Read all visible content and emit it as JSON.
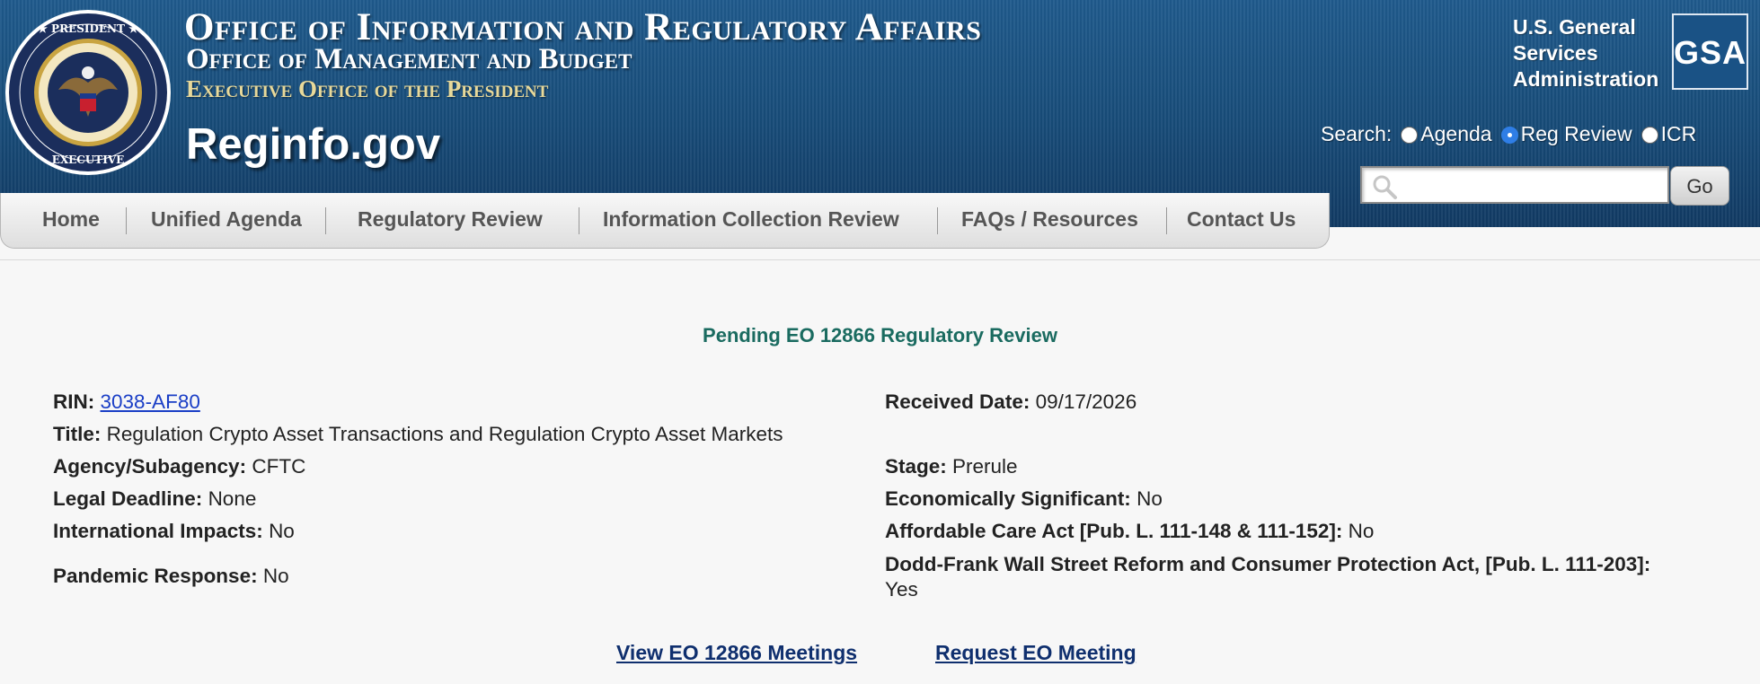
{
  "header": {
    "line1": "Office of Information and Regulatory Affairs",
    "line2": "Office of Management and Budget",
    "line3": "Executive Office of the President",
    "site_name": "Reginfo.gov",
    "gsa_name": [
      "U.S. General",
      "Services",
      "Administration"
    ],
    "gsa_logo_text": "GSA",
    "search": {
      "label": "Search:",
      "options": [
        "Agenda",
        "Reg Review",
        "ICR"
      ],
      "selected": "Reg Review",
      "value": "",
      "go_label": "Go"
    }
  },
  "nav": {
    "items": [
      "Home",
      "Unified Agenda",
      "Regulatory Review",
      "Information Collection Review",
      "FAQs / Resources",
      "Contact Us"
    ]
  },
  "main": {
    "heading": "Pending EO 12866 Regulatory Review",
    "rin": {
      "label": "RIN:",
      "value": "3038-AF80"
    },
    "title": {
      "label": "Title:",
      "value": "Regulation Crypto Asset Transactions and Regulation Crypto Asset Markets"
    },
    "agency": {
      "label": "Agency/Subagency:",
      "value": "CFTC"
    },
    "legal_deadline": {
      "label": "Legal Deadline:",
      "value": "None"
    },
    "international_impacts": {
      "label": "International Impacts:",
      "value": "No"
    },
    "pandemic_response": {
      "label": "Pandemic Response:",
      "value": "No"
    },
    "received_date": {
      "label": "Received Date:",
      "value": "09/17/2026"
    },
    "stage": {
      "label": "Stage:",
      "value": "Prerule"
    },
    "economically_significant": {
      "label": "Economically Significant:",
      "value": "No"
    },
    "aca": {
      "label": "Affordable Care Act [Pub. L. 111-148 & 111-152]:",
      "value": "No"
    },
    "dodd_frank": {
      "label": "Dodd-Frank Wall Street Reform and Consumer Protection Act, [Pub. L. 111-203]:",
      "value": "Yes"
    },
    "links": [
      "View EO 12866 Meetings",
      "Request EO Meeting"
    ]
  },
  "colors": {
    "header_blue": "#174b78",
    "heading_green": "#1a6b60",
    "link_blue": "#1a3ec6"
  }
}
